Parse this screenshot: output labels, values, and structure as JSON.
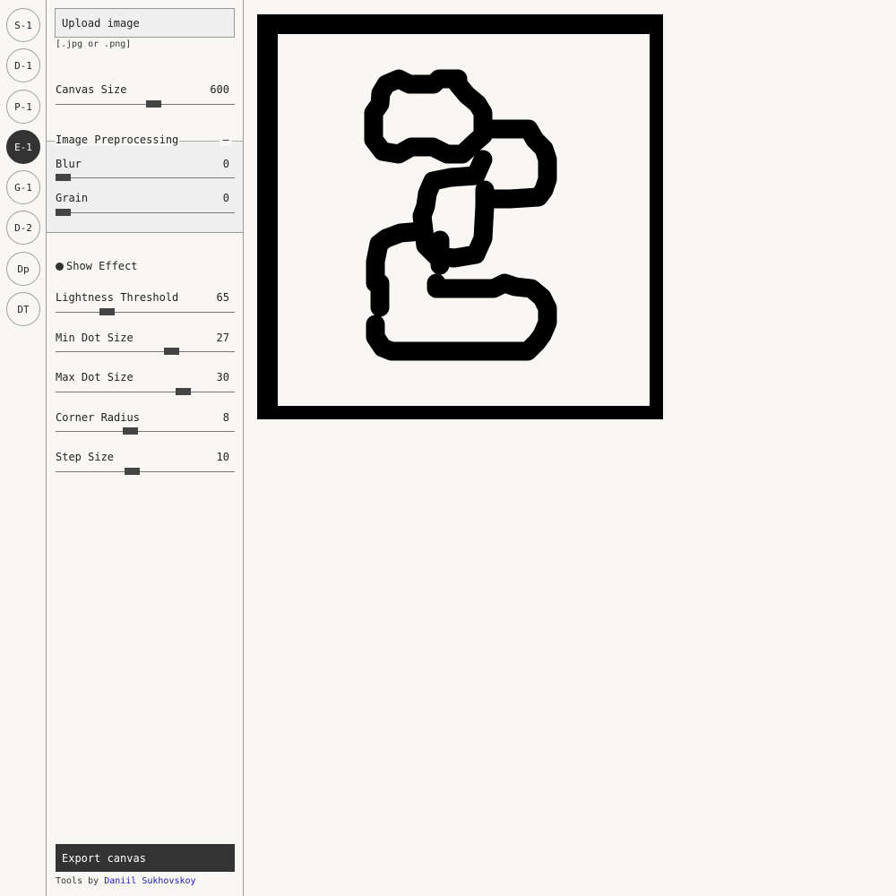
{
  "tools": [
    {
      "label": "S-1",
      "active": false
    },
    {
      "label": "D-1",
      "active": false
    },
    {
      "label": "P-1",
      "active": false
    },
    {
      "label": "E-1",
      "active": true
    },
    {
      "label": "G-1",
      "active": false
    },
    {
      "label": "D-2",
      "active": false
    },
    {
      "label": "Dp",
      "active": false
    },
    {
      "label": "DT",
      "active": false
    }
  ],
  "upload": {
    "label": "Upload image",
    "hint": "[.jpg or .png]"
  },
  "canvas_size": {
    "label": "Canvas Size",
    "value": "600",
    "level": 0.55
  },
  "preprocessing": {
    "title": "Image Preprocessing",
    "toggle": "–",
    "blur": {
      "label": "Blur",
      "value": "0",
      "level": 0.0
    },
    "grain": {
      "label": "Grain",
      "value": "0",
      "level": 0.0
    }
  },
  "show_effect": {
    "label": "Show Effect",
    "checked": true
  },
  "lightness_threshold": {
    "label": "Lightness Threshold",
    "value": "65",
    "level": 0.27
  },
  "min_dot_size": {
    "label": "Min Dot Size",
    "value": "27",
    "level": 0.66
  },
  "max_dot_size": {
    "label": "Max Dot Size",
    "value": "30",
    "level": 0.73
  },
  "corner_radius": {
    "label": "Corner Radius",
    "value": "8",
    "level": 0.41
  },
  "step_size": {
    "label": "Step Size",
    "value": "10",
    "level": 0.42
  },
  "export": {
    "label": "Export canvas"
  },
  "credit": {
    "prefix": "Tools by",
    "author": "Daniil Sukhovskoy"
  },
  "colors": {
    "accent": "#333333",
    "background": "#f8f7f3",
    "panel": "#efefef",
    "link": "#1a1ab0"
  }
}
